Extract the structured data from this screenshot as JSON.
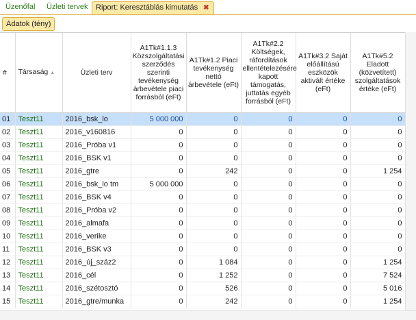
{
  "tabs": [
    {
      "label": "Üzenőfal"
    },
    {
      "label": "Üzleti tervek"
    },
    {
      "label": "Riport: Keresztáblás kimutatás"
    }
  ],
  "toolbar": {
    "data_button": "Adatok (tény)"
  },
  "columns": {
    "rownum": "#",
    "company": "Társaság",
    "plan": "Üzleti terv",
    "c1": "A1Tk#1.1.3 Közszolgáltatási szerződés szerinti tevékenység árbevétele piaci forrásból (eFt)",
    "c2": "A1Tk#1.2 Piaci tevékenység nettó árbevétele (eFt)",
    "c3": "A1Tk#2.2 Költségek, ráfordítások ellentételezésére kapott támogatás, juttatás egyéb forrásból (eFt)",
    "c4": "A1Tk#3.2 Saját előállítású eszközök aktivált értéke (eFt)",
    "c5": "A1Tk#5.2 Eladott (közvetített) szolgáltatások értéke (eFt)"
  },
  "rows": [
    {
      "n": "01",
      "company": "Teszt11",
      "plan": "2016_bsk_lo",
      "c1": "5 000 000",
      "c2": "0",
      "c3": "0",
      "c4": "0",
      "c5": "0"
    },
    {
      "n": "02",
      "company": "Teszt11",
      "plan": "2016_v160816",
      "c1": "0",
      "c2": "0",
      "c3": "0",
      "c4": "0",
      "c5": "0"
    },
    {
      "n": "03",
      "company": "Teszt11",
      "plan": "2016_Próba v1",
      "c1": "0",
      "c2": "0",
      "c3": "0",
      "c4": "0",
      "c5": "0"
    },
    {
      "n": "04",
      "company": "Teszt11",
      "plan": "2016_BSK v1",
      "c1": "0",
      "c2": "0",
      "c3": "0",
      "c4": "0",
      "c5": "0"
    },
    {
      "n": "05",
      "company": "Teszt11",
      "plan": "2016_gtre",
      "c1": "0",
      "c2": "242",
      "c3": "0",
      "c4": "0",
      "c5": "1 254"
    },
    {
      "n": "06",
      "company": "Teszt11",
      "plan": "2016_bsk_lo tm",
      "c1": "5 000 000",
      "c2": "0",
      "c3": "0",
      "c4": "0",
      "c5": "0"
    },
    {
      "n": "07",
      "company": "Teszt11",
      "plan": "2016_BSK v4",
      "c1": "0",
      "c2": "0",
      "c3": "0",
      "c4": "0",
      "c5": "0"
    },
    {
      "n": "08",
      "company": "Teszt11",
      "plan": "2016_Próba v2",
      "c1": "0",
      "c2": "0",
      "c3": "0",
      "c4": "0",
      "c5": "0"
    },
    {
      "n": "09",
      "company": "Teszt11",
      "plan": "2016_almafa",
      "c1": "0",
      "c2": "0",
      "c3": "0",
      "c4": "0",
      "c5": "0"
    },
    {
      "n": "10",
      "company": "Teszt11",
      "plan": "2016_verike",
      "c1": "0",
      "c2": "0",
      "c3": "0",
      "c4": "0",
      "c5": "0"
    },
    {
      "n": "11",
      "company": "Teszt11",
      "plan": "2016_BSK v3",
      "c1": "0",
      "c2": "0",
      "c3": "0",
      "c4": "0",
      "c5": "0"
    },
    {
      "n": "12",
      "company": "Teszt11",
      "plan": "2016_új_száz2",
      "c1": "0",
      "c2": "1 084",
      "c3": "0",
      "c4": "0",
      "c5": "1 254"
    },
    {
      "n": "13",
      "company": "Teszt11",
      "plan": "2016_cél",
      "c1": "0",
      "c2": "1 252",
      "c3": "0",
      "c4": "0",
      "c5": "7 524"
    },
    {
      "n": "14",
      "company": "Teszt11",
      "plan": "2016_szétosztó",
      "c1": "0",
      "c2": "526",
      "c3": "0",
      "c4": "0",
      "c5": "5 016"
    },
    {
      "n": "15",
      "company": "Teszt11",
      "plan": "2016_gtre/munka",
      "c1": "0",
      "c2": "242",
      "c3": "0",
      "c4": "0",
      "c5": "1 254"
    }
  ],
  "colors": {
    "accent_tab": "#fbe9a8",
    "selected_row": "#c6dffa",
    "green_text": "#1b6e10"
  }
}
